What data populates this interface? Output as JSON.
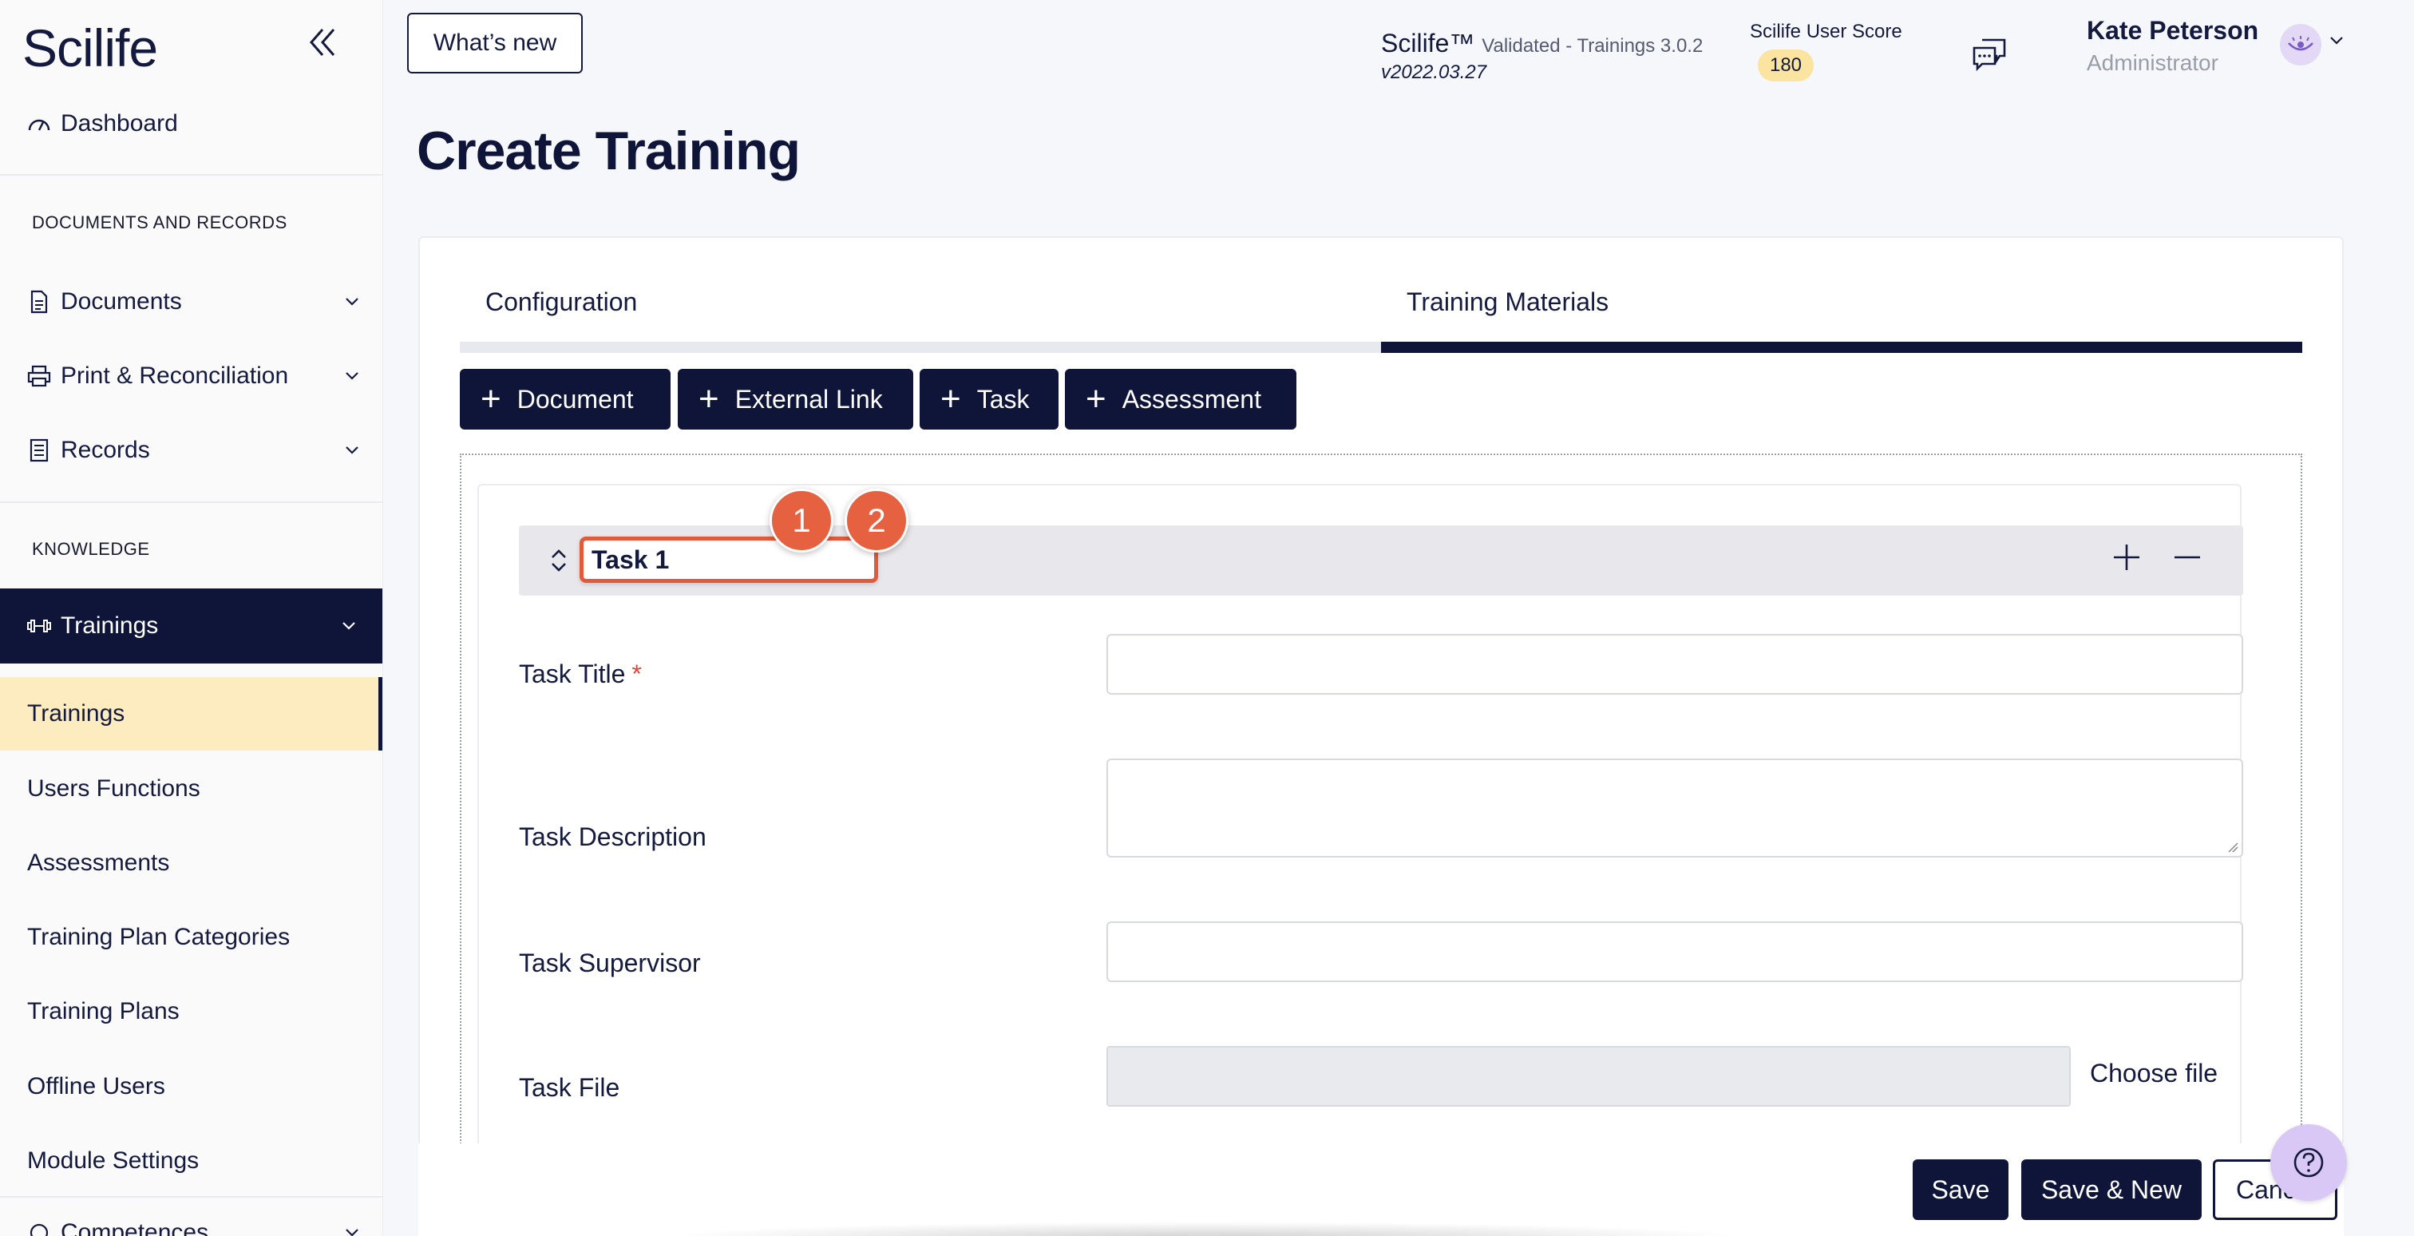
{
  "sidebar": {
    "logo": "Scilife",
    "dashboard_label": "Dashboard",
    "section_documents": "DOCUMENTS AND RECORDS",
    "documents_label": "Documents",
    "print_label": "Print & Reconciliation",
    "records_label": "Records",
    "section_knowledge": "KNOWLEDGE",
    "trainings_group_label": "Trainings",
    "sub_items": [
      "Trainings",
      "Users Functions",
      "Assessments",
      "Training Plan Categories",
      "Training Plans",
      "Offline Users",
      "Module Settings"
    ],
    "next_group_label": "Competences"
  },
  "header": {
    "whats_new": "What’s new",
    "product": "Scilife™",
    "product_detail": "Validated - Trainings 3.0.2",
    "version": "v2022.03.27",
    "score_label": "Scilife User Score",
    "score_value": "180",
    "user_name": "Kate Peterson",
    "user_role": "Administrator"
  },
  "main": {
    "title": "Create Training",
    "tabs": [
      "Configuration",
      "Training Materials"
    ],
    "active_tab": "Training Materials",
    "add_buttons": [
      "Document",
      "External Link",
      "Task",
      "Assessment"
    ],
    "task": {
      "name": "Task 1",
      "markers": [
        "1",
        "2"
      ],
      "fields": {
        "title_label": "Task Title",
        "required_mark": "*",
        "description_label": "Task Description",
        "supervisor_label": "Task Supervisor",
        "file_label": "Task File",
        "choose_file": "Choose file"
      }
    }
  },
  "footer": {
    "save": "Save",
    "save_new": "Save & New",
    "cancel": "Cancel"
  },
  "colors": {
    "navy": "#0e1538",
    "highlight": "#fdecc0",
    "marker": "#e5613f",
    "badge": "#fbe3a0"
  }
}
